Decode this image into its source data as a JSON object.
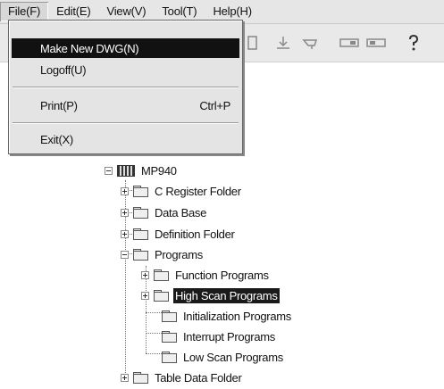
{
  "menubar": {
    "items": [
      {
        "label": "File(F)"
      },
      {
        "label": "Edit(E)"
      },
      {
        "label": "View(V)"
      },
      {
        "label": "Tool(T)"
      },
      {
        "label": "Help(H)"
      }
    ]
  },
  "file_menu": {
    "items": [
      {
        "label": "Make New DWG(N)",
        "shortcut": ""
      },
      {
        "label": "Logoff(U)",
        "shortcut": ""
      },
      {
        "label": "Print(P)",
        "shortcut": "Ctrl+P"
      },
      {
        "label": "Exit(X)",
        "shortcut": ""
      }
    ]
  },
  "toolbar": {
    "icons": [
      "button-icon",
      "download-icon",
      "upload-icon",
      "panel-icon",
      "panel-icon-2",
      "help-icon"
    ]
  },
  "tree": {
    "partial_label": "...",
    "root": "MP940",
    "items": [
      {
        "label": "C Register Folder"
      },
      {
        "label": "Data Base"
      },
      {
        "label": "Definition Folder"
      },
      {
        "label": "Programs"
      },
      {
        "label": "Function Programs"
      },
      {
        "label": "High Scan Programs"
      },
      {
        "label": "Initialization Programs"
      },
      {
        "label": "Interrupt Programs"
      },
      {
        "label": "Low Scan Programs"
      },
      {
        "label": "Table Data Folder"
      }
    ]
  },
  "colors": {
    "highlight": "#111111",
    "menu_bg": "#e4e4e4",
    "tree_bg": "#ffffff"
  }
}
